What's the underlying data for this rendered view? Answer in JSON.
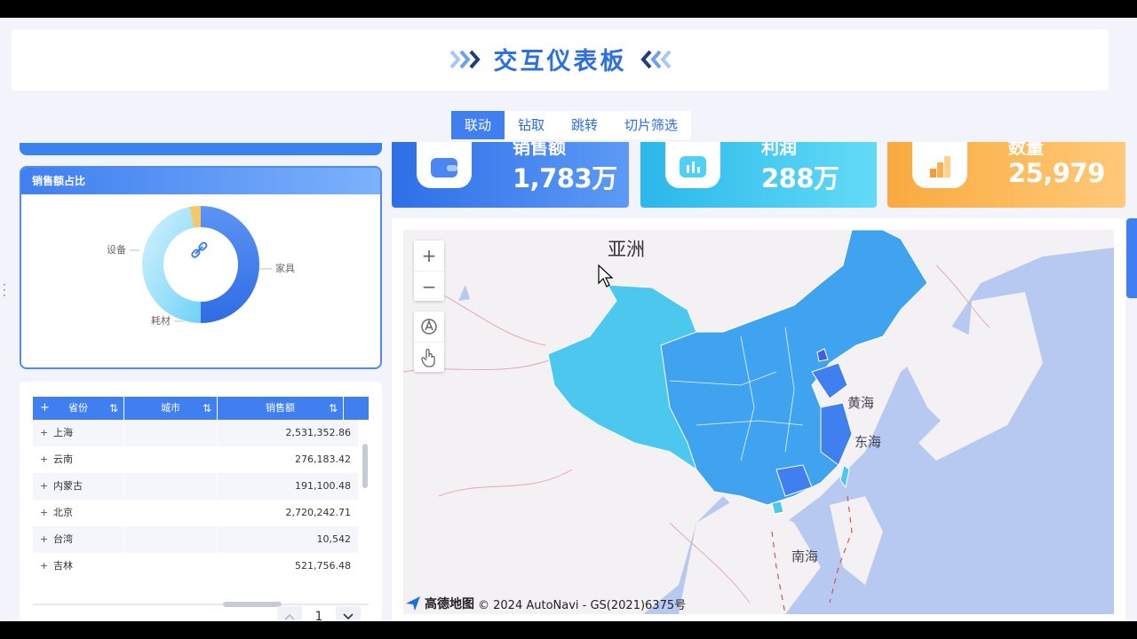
{
  "header": {
    "title": "交互仪表板"
  },
  "tabs": [
    {
      "label": "联动",
      "active": true
    },
    {
      "label": "钻取",
      "active": false
    },
    {
      "label": "跳转",
      "active": false
    },
    {
      "label": "切片筛选",
      "active": false
    }
  ],
  "pie_panel": {
    "title": "销售额占比",
    "center_icon": "link-icon",
    "labels": {
      "a": "设备",
      "b": "家具",
      "c": "耗材"
    }
  },
  "chart_data": {
    "type": "pie",
    "title": "销售额占比",
    "categories": [
      "家具",
      "设备",
      "耗材"
    ],
    "values": [
      0.5,
      0.47,
      0.03
    ],
    "colors": [
      "#3f7ff0",
      "#8fe0fb",
      "#f6c66a"
    ]
  },
  "table": {
    "headers": {
      "province": "省份",
      "city": "城市",
      "sales": "销售额"
    },
    "rows": [
      {
        "province": "上海",
        "city": "",
        "sales": "2,531,352.86"
      },
      {
        "province": "云南",
        "city": "",
        "sales": "276,183.42"
      },
      {
        "province": "内蒙古",
        "city": "",
        "sales": "191,100.48"
      },
      {
        "province": "北京",
        "city": "",
        "sales": "2,720,242.71"
      },
      {
        "province": "台湾",
        "city": "",
        "sales": "10,542"
      },
      {
        "province": "吉林",
        "city": "",
        "sales": "521,756.48"
      }
    ],
    "expand_glyph": "+",
    "sort_glyph": "⇅",
    "page": "1"
  },
  "kpis": [
    {
      "label": "销售额",
      "value": "1,783万",
      "icon": "wallet-icon"
    },
    {
      "label": "利润",
      "value": "288万",
      "icon": "bar-chart-icon"
    },
    {
      "label": "数量",
      "value": "25,979",
      "icon": "stacked-bars-icon"
    }
  ],
  "map": {
    "labels": {
      "asia": "亚洲",
      "yellow_sea": "黄海",
      "east_sea": "东海",
      "south_sea": "南海"
    },
    "footer_brand": "高德地图",
    "footer_text": "© 2024 AutoNavi - GS(2021)6375号",
    "controls": {
      "zoom_in": "+",
      "zoom_out": "−"
    }
  }
}
